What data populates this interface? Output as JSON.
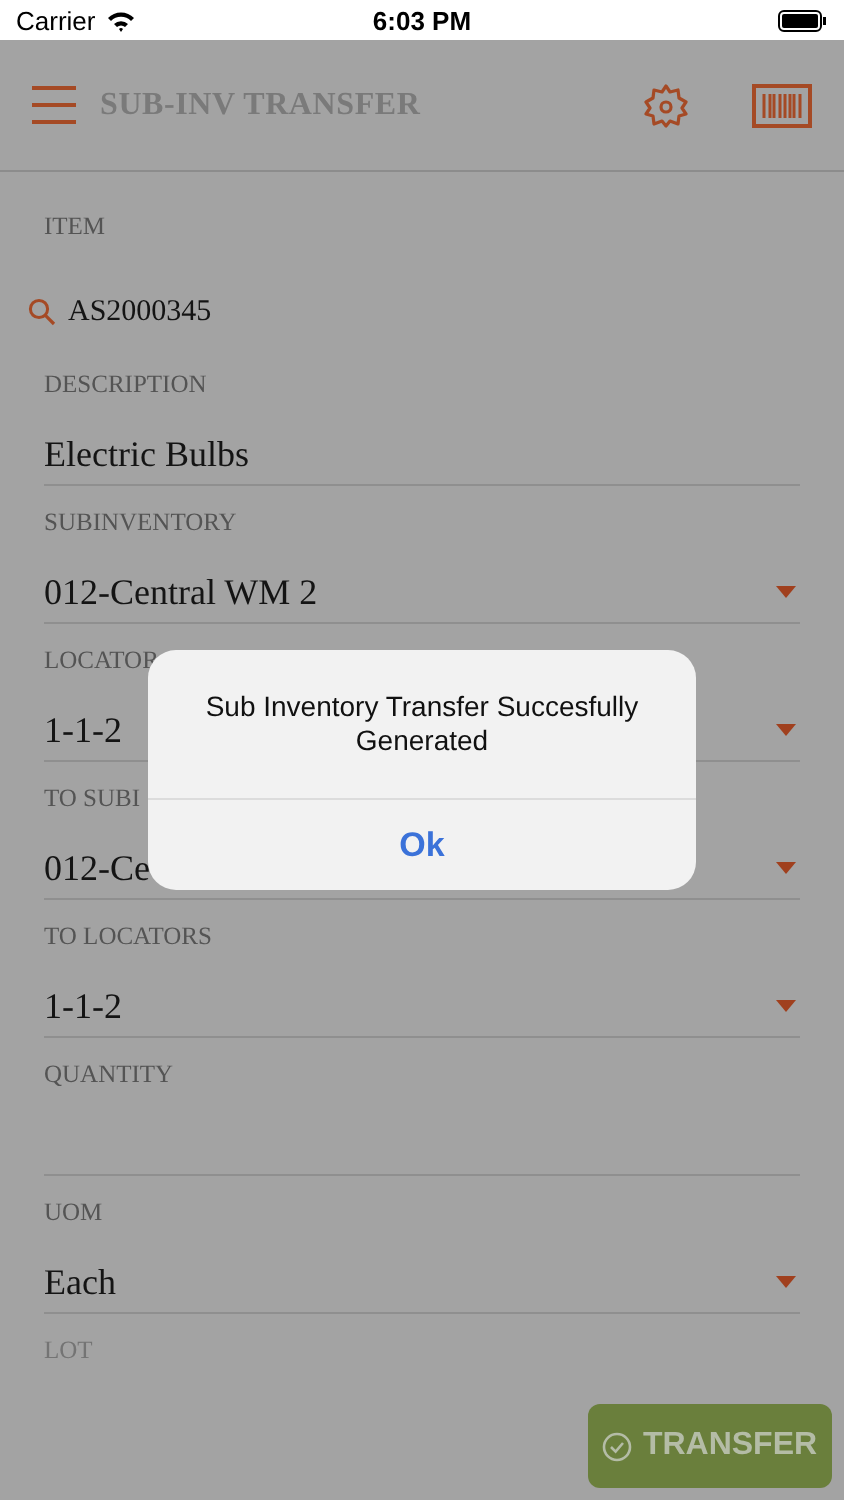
{
  "status_bar": {
    "carrier": "Carrier",
    "time": "6:03 PM"
  },
  "header": {
    "title": "SUB-INV TRANSFER"
  },
  "fields": [
    {
      "kind": "search",
      "label": "ITEM",
      "value": "AS2000345",
      "disabled": false
    },
    {
      "kind": "text",
      "label": "DESCRIPTION",
      "value": "Electric Bulbs",
      "disabled": false
    },
    {
      "kind": "dropdown",
      "label": "SUBINVENTORY",
      "value": "012-Central WM 2",
      "disabled": false
    },
    {
      "kind": "dropdown",
      "label": "LOCATOR",
      "value": "1-1-2",
      "disabled": false
    },
    {
      "kind": "dropdown",
      "label": "TO SUBI",
      "value": "012-Ce",
      "disabled": false
    },
    {
      "kind": "dropdown",
      "label": "TO LOCATORS",
      "value": "1-1-2",
      "disabled": false
    },
    {
      "kind": "text",
      "label": "QUANTITY",
      "disabled": false
    },
    {
      "kind": "dropdown",
      "label": "UOM",
      "value": "Each",
      "disabled": false
    },
    {
      "kind": "text",
      "label": "LOT",
      "disabled": true
    }
  ],
  "alert": {
    "message": "Sub Inventory Transfer Succesfully Generated",
    "button": "Ok"
  },
  "transfer_button": {
    "label": "TRANSFER"
  }
}
